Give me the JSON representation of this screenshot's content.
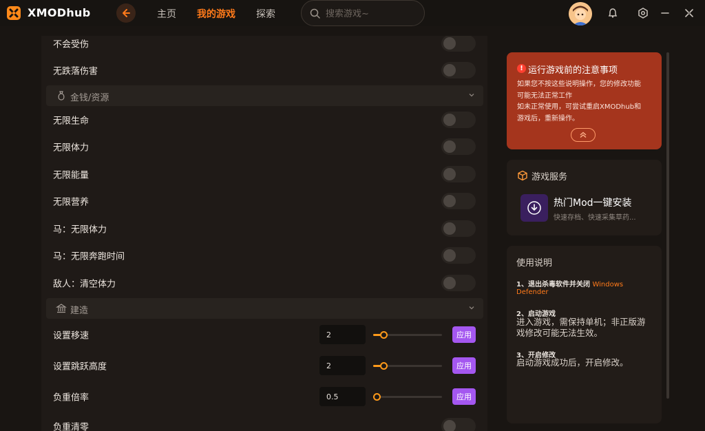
{
  "app": {
    "brand": "XMODhub"
  },
  "nav": {
    "home": "主页",
    "my_games": "我的游戏",
    "explore": "探索"
  },
  "search": {
    "placeholder": "搜索游戏~"
  },
  "colors": {
    "accent": "#ff7a1a",
    "apply": "#a457f0",
    "notice": "#a5351d"
  },
  "cheats": {
    "no_damage": "不会受伤",
    "no_fall_damage": "无跌落伤害",
    "section_money": "金钱/资源",
    "infinite_health": "无限生命",
    "infinite_stamina": "无限体力",
    "infinite_energy": "无限能量",
    "infinite_nutrition": "无限营养",
    "horse_stamina": "马：无限体力",
    "horse_sprint": "马：无限奔跑时间",
    "enemy_stamina": "敌人：清空体力",
    "section_build": "建造",
    "move_speed": "设置移速",
    "move_speed_value": "2",
    "jump_height": "设置跳跃高度",
    "jump_height_value": "2",
    "weight_rate": "负重倍率",
    "weight_rate_value": "0.5",
    "weight_clear": "负重清零",
    "apply": "应用"
  },
  "sliders": {
    "move_speed": 0.12,
    "jump_height": 0.12,
    "weight_rate": 0.0
  },
  "notice": {
    "title": "运行游戏前的注意事项",
    "line1": "如果您不按这些说明操作，您的修改功能",
    "line2": "可能无法正常工作",
    "line3": "如未正常使用，可尝试重启XMODhub和",
    "line4": "游戏后，重新操作。"
  },
  "service": {
    "title": "游戏服务",
    "item_title": "热门Mod一键安装",
    "item_sub": "快速存档、快速采集草药..."
  },
  "guide": {
    "title": "使用说明",
    "step1": "1、退出杀毒软件并关闭",
    "step1_hl": "Windows",
    "step1_hl2": "Defender",
    "step2": "2、启动游戏",
    "step2_text1": "进入游戏，需保持单机；非正版游",
    "step2_text2": "戏修改可能无法生效。",
    "step3": "3、开启修改",
    "step3_text": "启动游戏成功后，开启修改。"
  }
}
